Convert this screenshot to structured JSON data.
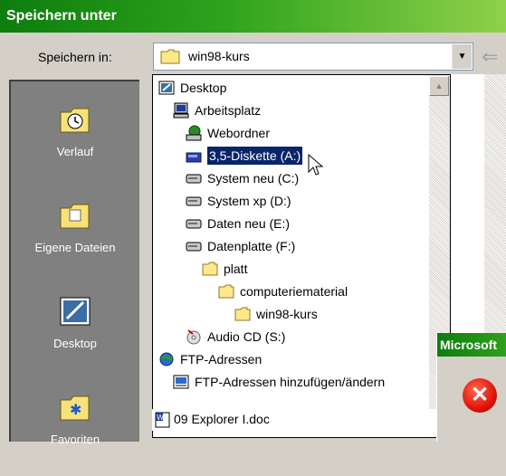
{
  "window": {
    "title": "Speichern unter"
  },
  "toolbar": {
    "save_in_label": "Speichern in:",
    "save_in_value": "win98-kurs",
    "back_icon": "back-arrow-icon"
  },
  "places": [
    {
      "label": "Verlauf",
      "icon": "history-folder-icon"
    },
    {
      "label": "Eigene Dateien",
      "icon": "my-documents-folder-icon"
    },
    {
      "label": "Desktop",
      "icon": "desktop-icon"
    },
    {
      "label": "Favoriten",
      "icon": "favorites-folder-icon"
    }
  ],
  "dropdown": {
    "items": [
      {
        "label": "Desktop",
        "icon": "desktop-icon",
        "level": 0
      },
      {
        "label": "Arbeitsplatz",
        "icon": "computer-icon",
        "level": 1
      },
      {
        "label": "Webordner",
        "icon": "web-folder-icon",
        "level": 2
      },
      {
        "label": "3,5-Diskette (A:)",
        "icon": "floppy-drive-icon",
        "level": 2,
        "selected": true
      },
      {
        "label": "System neu (C:)",
        "icon": "hard-drive-icon",
        "level": 2
      },
      {
        "label": "System xp (D:)",
        "icon": "hard-drive-icon",
        "level": 2
      },
      {
        "label": "Daten neu (E:)",
        "icon": "hard-drive-icon",
        "level": 2
      },
      {
        "label": "Datenplatte (F:)",
        "icon": "hard-drive-icon",
        "level": 2
      },
      {
        "label": "platt",
        "icon": "folder-icon",
        "level": 3
      },
      {
        "label": "computeriematerial",
        "icon": "folder-icon",
        "level": 4
      },
      {
        "label": "win98-kurs",
        "icon": "folder-icon",
        "level": 5
      },
      {
        "label": "Audio CD (S:)",
        "icon": "cd-drive-icon",
        "level": 2
      },
      {
        "label": "FTP-Adressen",
        "icon": "ftp-globe-icon",
        "level": 0
      },
      {
        "label": "FTP-Adressen hinzufügen/ändern",
        "icon": "ftp-add-icon",
        "level": 1
      }
    ]
  },
  "file_list": {
    "first_item": "09 Explorer I.doc"
  },
  "message_box": {
    "title": "Microsoft",
    "icon": "error-icon"
  }
}
